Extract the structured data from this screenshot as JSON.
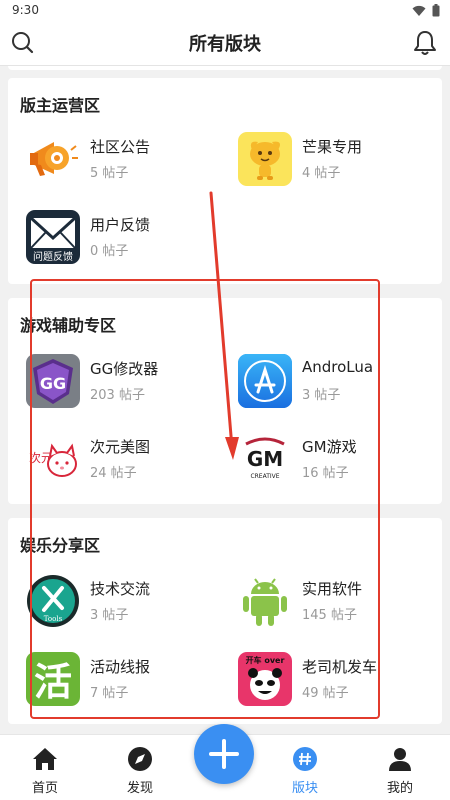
{
  "status_bar": {
    "time": "9:30"
  },
  "header": {
    "title": "所有版块"
  },
  "sections": [
    {
      "title": "版主运营区",
      "boards": [
        {
          "name": "社区公告",
          "count": "5 帖子",
          "icon": "megaphone-icon"
        },
        {
          "name": "芒果专用",
          "count": "4 帖子",
          "icon": "mango-mascot-icon"
        },
        {
          "name": "用户反馈",
          "count": "0 帖子",
          "icon": "envelope-icon",
          "icon_caption": "问题反馈"
        }
      ]
    },
    {
      "title": "游戏辅助专区",
      "boards": [
        {
          "name": "GG修改器",
          "count": "203 帖子",
          "icon": "gameguardian-icon",
          "icon_text": "GG"
        },
        {
          "name": "AndroLua",
          "count": "3 帖子",
          "icon": "app-store-icon"
        },
        {
          "name": "次元美图",
          "count": "24 帖子",
          "icon": "anime-cat-icon",
          "icon_text": "次元"
        },
        {
          "name": "GM游戏",
          "count": "16 帖子",
          "icon": "gm-logo-icon",
          "icon_text": "GM",
          "icon_caption": "CREATIVE"
        }
      ]
    },
    {
      "title": "娱乐分享区",
      "boards": [
        {
          "name": "技术交流",
          "count": "3 帖子",
          "icon": "tools-icon",
          "icon_caption": "Tools"
        },
        {
          "name": "实用软件",
          "count": "145 帖子",
          "icon": "android-icon"
        },
        {
          "name": "活动线报",
          "count": "7 帖子",
          "icon": "huo-character-icon",
          "icon_text": "活"
        },
        {
          "name": "老司机发车",
          "count": "49 帖子",
          "icon": "panda-meme-icon",
          "icon_text": "开车 over"
        }
      ]
    }
  ],
  "bottom_nav": [
    {
      "label": "首页",
      "icon": "home-icon"
    },
    {
      "label": "发现",
      "icon": "compass-icon"
    },
    {
      "label": "版块",
      "icon": "hash-icon",
      "active": true
    },
    {
      "label": "我的",
      "icon": "person-icon"
    }
  ],
  "fab": {
    "icon": "plus-icon"
  },
  "colors": {
    "accent": "#3a8ff2",
    "annotation": "#e23b2c",
    "page_bg": "#f1f1f1"
  }
}
